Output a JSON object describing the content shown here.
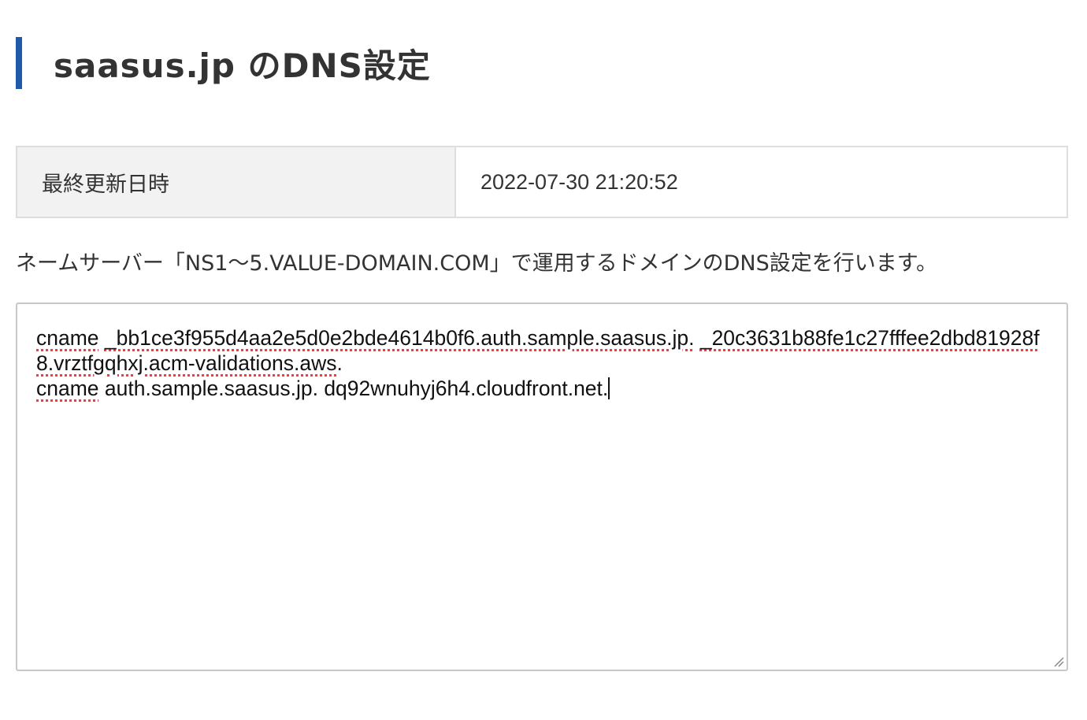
{
  "header": {
    "title": "saasus.jp のDNS設定",
    "accent_color": "#1e5aa8"
  },
  "info": {
    "last_updated_label": "最終更新日時",
    "last_updated_value": "2022-07-30 21:20:52"
  },
  "description": "ネームサーバー「NS1〜5.VALUE-DOMAIN.COM」で運用するドメインのDNS設定を行います。",
  "dns_records": {
    "line1_type": "cname",
    "line1_name": "_bb1ce3f955d4aa2e5d0e2bde4614b0f6.auth.sample.saasus.jp.",
    "line1_value": "_20c3631b88fe1c27fffee2dbd81928f8.vrztfgqhxj.acm-validations.aws",
    "line1_trailing": ".",
    "line2_type": "cname",
    "line2_rest": " auth.sample.saasus.jp. dq92wnuhyj6h4.cloudfront.net.",
    "spellcheck_color": "#e04646"
  }
}
